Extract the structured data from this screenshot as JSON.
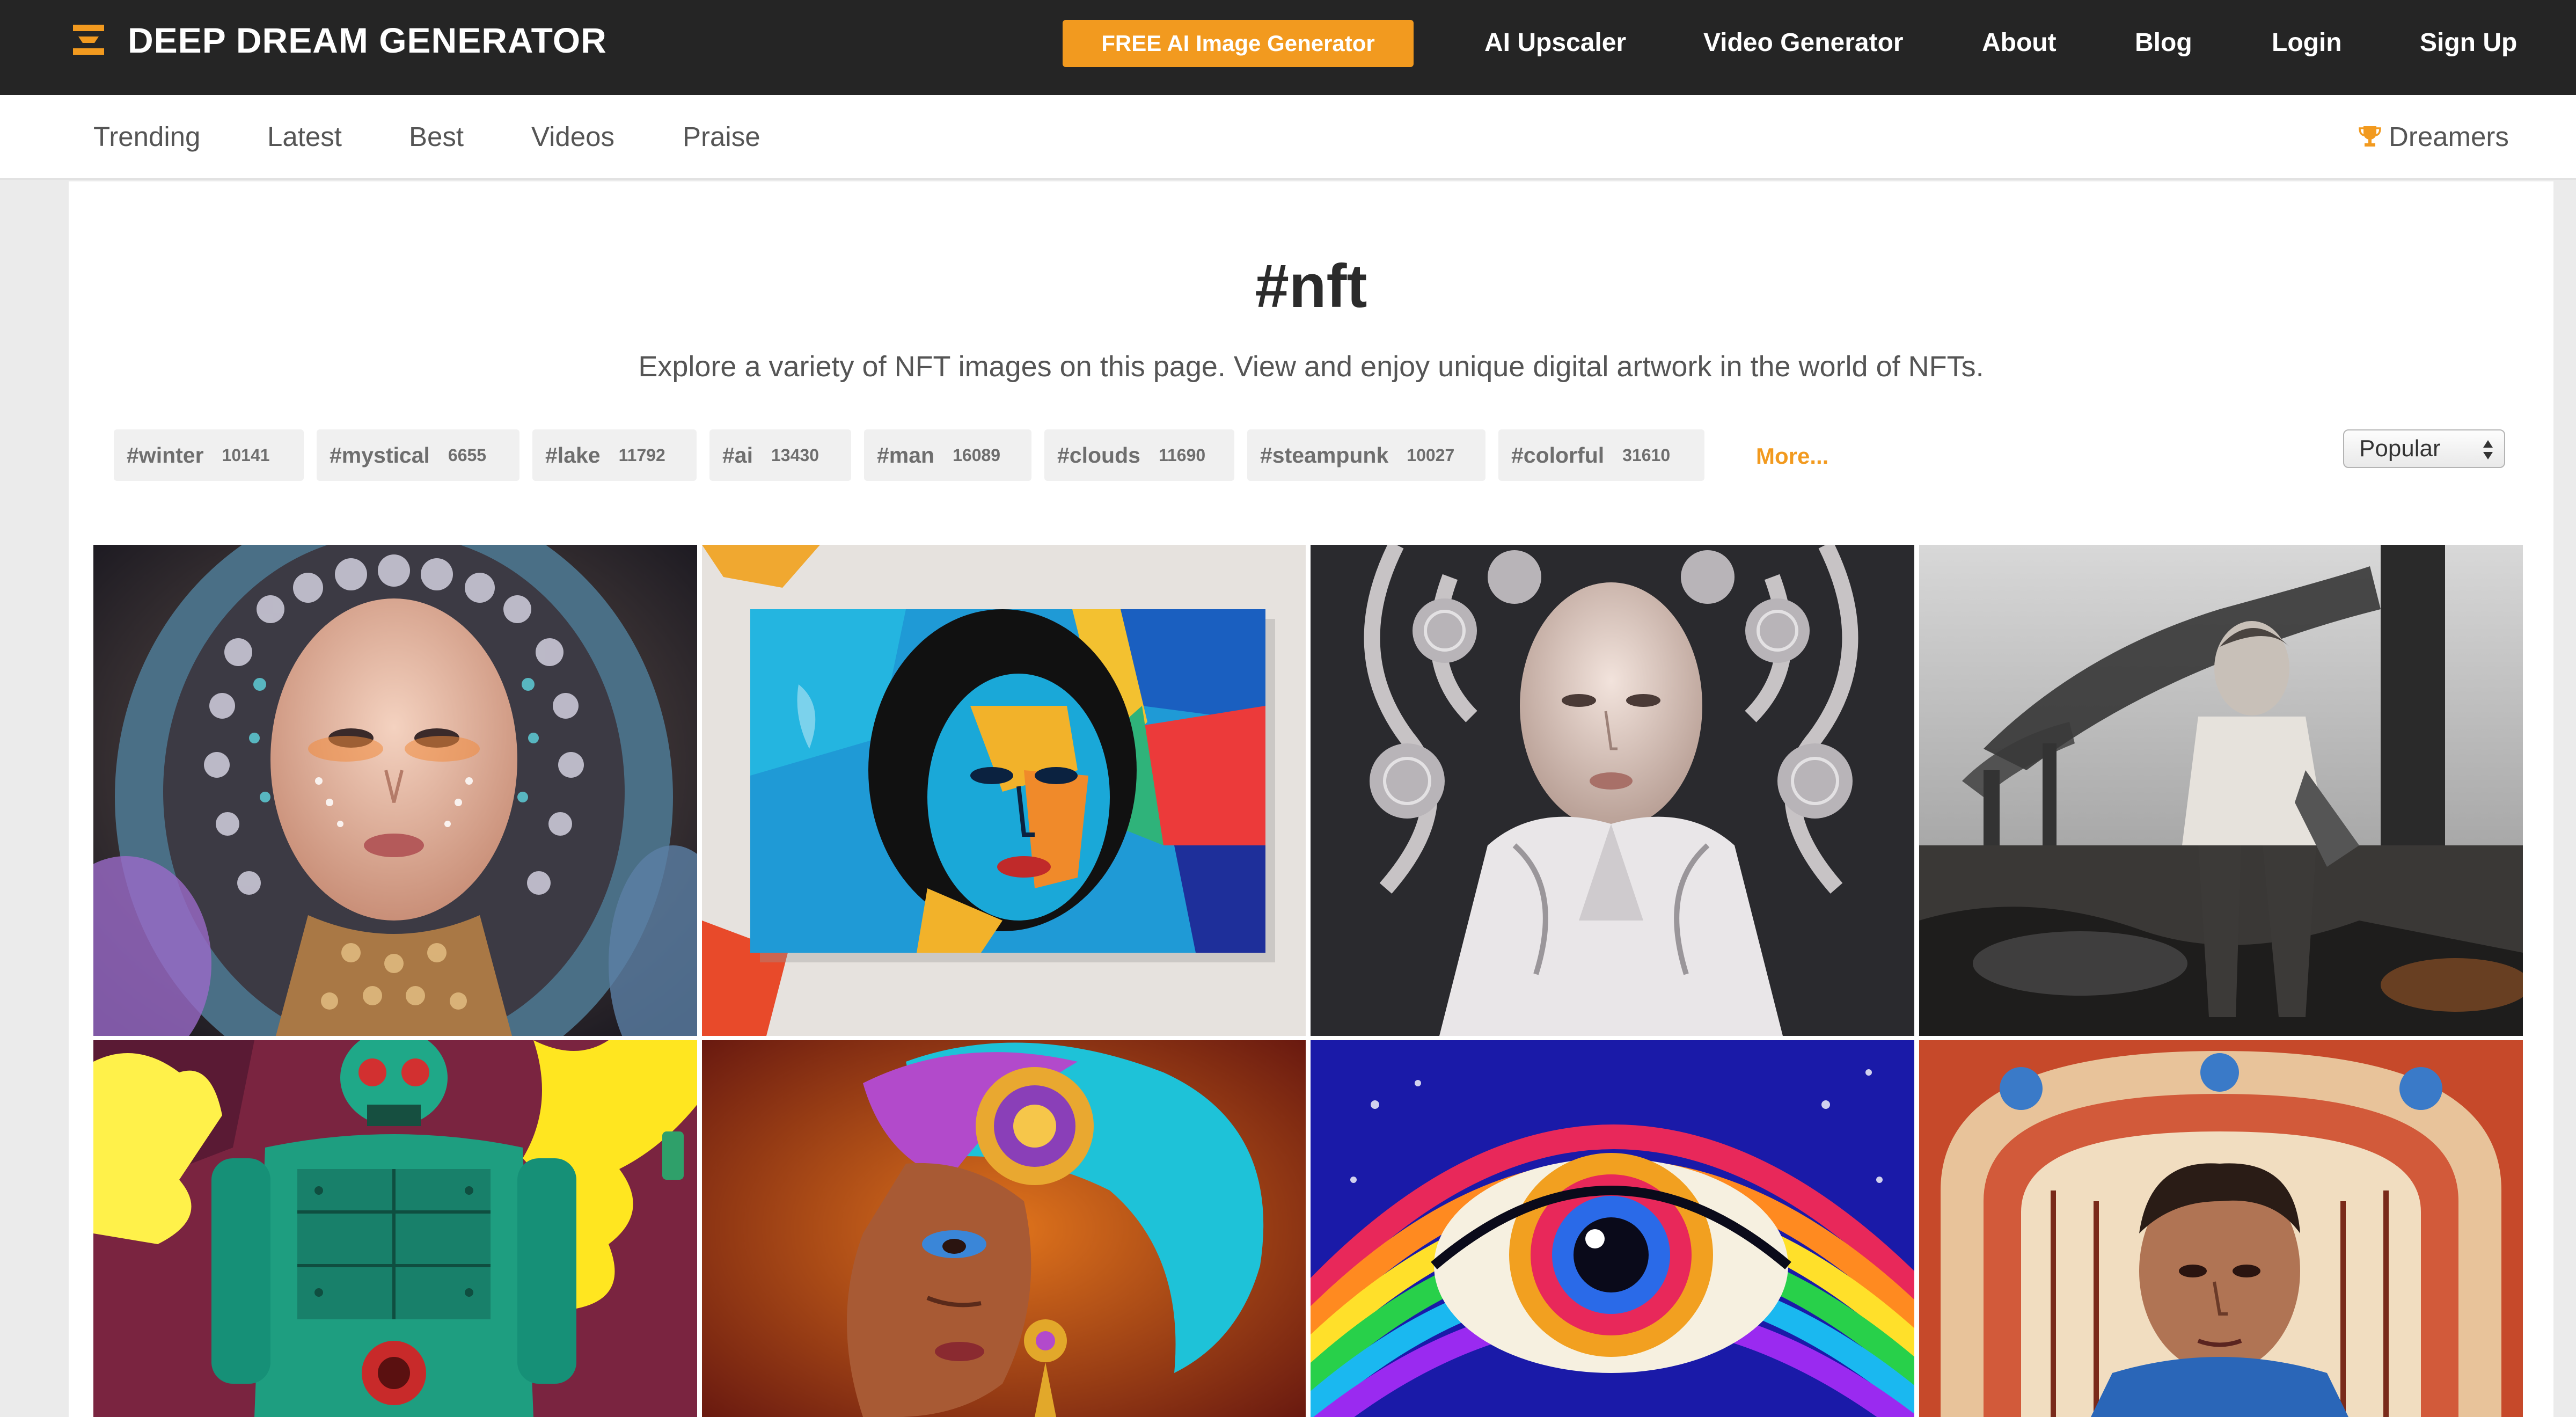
{
  "header": {
    "brand": "DEEP DREAM GENERATOR",
    "cta_label": "FREE AI Image Generator",
    "nav": [
      "AI Upscaler",
      "Video Generator",
      "About",
      "Blog",
      "Login",
      "Sign Up"
    ]
  },
  "subnav": {
    "items": [
      "Trending",
      "Latest",
      "Best",
      "Videos",
      "Praise"
    ],
    "dreamers_label": "Dreamers"
  },
  "page": {
    "title": "#nft",
    "description": "Explore a variety of NFT images on this page. View and enjoy unique digital artwork in the world of NFTs."
  },
  "tags": [
    {
      "name": "#winter",
      "count": "10141"
    },
    {
      "name": "#mystical",
      "count": "6655"
    },
    {
      "name": "#lake",
      "count": "11792"
    },
    {
      "name": "#ai",
      "count": "13430"
    },
    {
      "name": "#man",
      "count": "16089"
    },
    {
      "name": "#clouds",
      "count": "11690"
    },
    {
      "name": "#steampunk",
      "count": "10027"
    },
    {
      "name": "#colorful",
      "count": "31610"
    }
  ],
  "tags_more_label": "More...",
  "sort": {
    "selected": "Popular"
  },
  "colors": {
    "accent": "#f29a1f",
    "topbar": "#252525",
    "background": "#ebebeb"
  },
  "icons": {
    "logo": "layered-bars-icon",
    "dreamers": "trophy-icon",
    "sort": "up-down-arrows-icon"
  },
  "gallery": [
    {
      "subject": "jeweled-hooded-woman"
    },
    {
      "subject": "painted-canvas-portrait"
    },
    {
      "subject": "white-filigree-woman"
    },
    {
      "subject": "boy-smokestacks-monochrome"
    },
    {
      "subject": "green-robot-yellow-smoke"
    },
    {
      "subject": "woman-turquoise-turban"
    },
    {
      "subject": "psychedelic-rainbow-eye"
    },
    {
      "subject": "man-ornate-arch"
    }
  ]
}
